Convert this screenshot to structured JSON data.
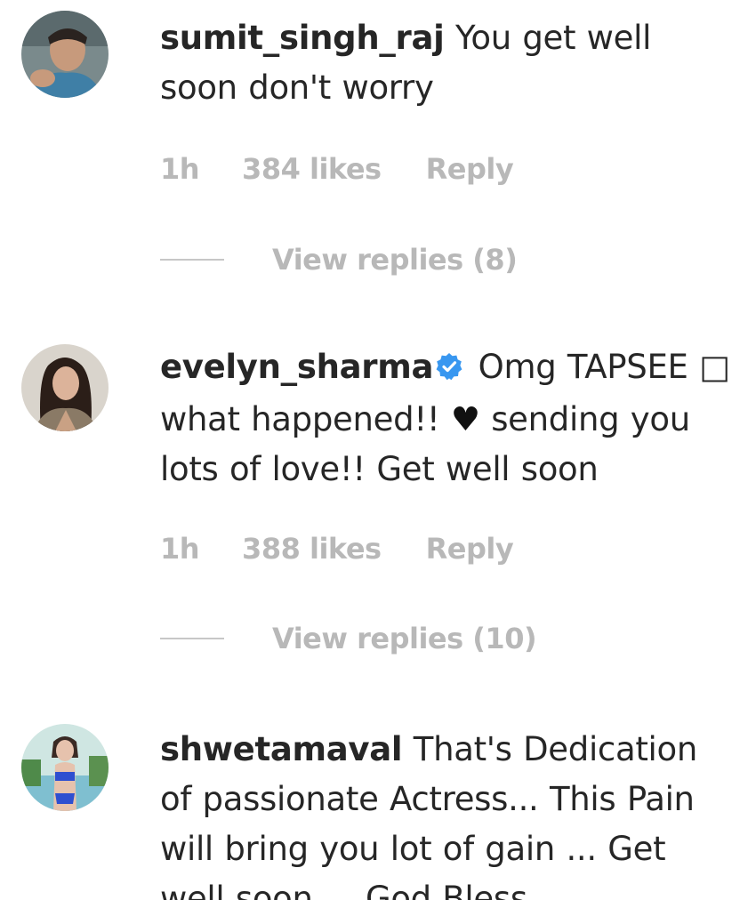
{
  "comments": [
    {
      "username": "sumit_singh_raj",
      "verified": false,
      "text": "You get well soon don't worry",
      "time": "1h",
      "likes": "384 likes",
      "reply": "Reply",
      "view_replies": "View replies (8)"
    },
    {
      "username": "evelyn_sharma",
      "verified": true,
      "text_part1": "Omg TAPSEE □ what happened!!",
      "heart": "♥",
      "text_part2": "sending you lots of love!! Get well soon",
      "time": "1h",
      "likes": "388 likes",
      "reply": "Reply",
      "view_replies": "View replies (10)"
    },
    {
      "username": "shwetamaval",
      "verified": false,
      "text": "That's Dedication of passionate Actress... This Pain will bring you lot of gain ... Get well soon ... God Bless"
    }
  ],
  "colors": {
    "text": "#262626",
    "secondary": "#b8b8b8",
    "verified_badge": "#3897f0",
    "divider": "#c7c7c7"
  },
  "icons": {
    "verified": "verified-badge-icon",
    "heart": "heart-emoji-icon"
  }
}
